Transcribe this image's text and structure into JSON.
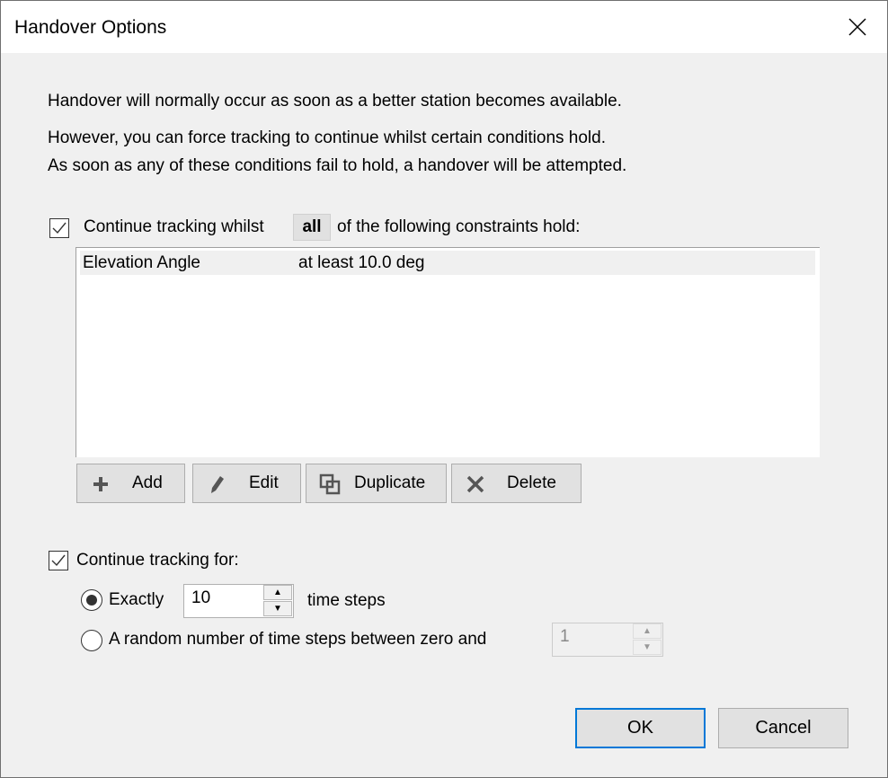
{
  "window": {
    "title": "Handover Options"
  },
  "intro": {
    "line1": "Handover will normally occur as soon as a better station becomes available.",
    "line2": "However, you can force tracking to continue whilst certain conditions hold.",
    "line3": "As soon as any of these conditions fail to hold, a handover will be attempted."
  },
  "constraints": {
    "checked": true,
    "label_before": "Continue tracking whilst",
    "combo_value": "all",
    "label_after": "of the following constraints hold:",
    "rows": [
      {
        "name": "Elevation Angle",
        "condition": "at least 10.0 deg"
      }
    ],
    "buttons": {
      "add": "Add",
      "edit": "Edit",
      "duplicate": "Duplicate",
      "delete": "Delete"
    }
  },
  "duration": {
    "checked": true,
    "label": "Continue tracking for:",
    "exactly": {
      "selected": true,
      "label": "Exactly",
      "value": "10",
      "suffix": "time steps"
    },
    "random": {
      "selected": false,
      "label": "A random number of time steps between zero and",
      "value": "1"
    }
  },
  "footer": {
    "ok": "OK",
    "cancel": "Cancel"
  },
  "colors": {
    "accent": "#0078d7"
  }
}
